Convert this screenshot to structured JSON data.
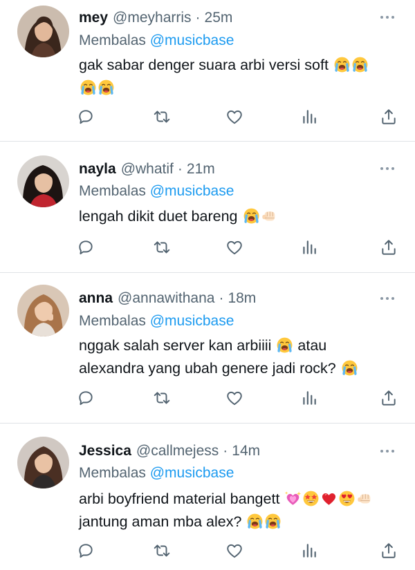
{
  "reply_prefix": "Membalas",
  "colors": {
    "link": "#1d9bf0",
    "secondary": "#536471",
    "text": "#0f1419"
  },
  "action_icons": [
    "reply-icon",
    "retweet-icon",
    "like-icon",
    "views-icon",
    "share-icon"
  ],
  "tweets": [
    {
      "name": "mey",
      "handle": "@meyharris",
      "dot": "·",
      "time": "25m",
      "reply_to": "@musicbase",
      "line1": "gak sabar denger suara arbi versi soft",
      "line2": "",
      "emojis": [
        "loudly-crying-face",
        "loudly-crying-face",
        "loudly-crying-face",
        "loudly-crying-face"
      ]
    },
    {
      "name": "nayla",
      "handle": "@whatif",
      "dot": "·",
      "time": "21m",
      "reply_to": "@musicbase",
      "line1": "lengah dikit duet bareng",
      "line2": "",
      "emojis": [
        "loudly-crying-face",
        "oncoming-fist"
      ]
    },
    {
      "name": "anna",
      "handle": "@annawithana",
      "dot": "·",
      "time": "18m",
      "reply_to": "@musicbase",
      "line1": "nggak salah server kan arbiiii",
      "line1_after": "atau",
      "line2": "alexandra yang ubah genere jadi rock?",
      "emojis": [
        "loudly-crying-face",
        "loudly-crying-face"
      ]
    },
    {
      "name": "Jessica",
      "handle": "@callmejess",
      "dot": "·",
      "time": "14m",
      "reply_to": "@musicbase",
      "line1": "arbi boyfriend material bangett",
      "line2": "jantung aman mba alex?",
      "emojis": [
        "sparkling-heart",
        "star-struck",
        "red-heart",
        "smiling-face-with-heart-eyes",
        "oncoming-fist",
        "loudly-crying-face",
        "loudly-crying-face"
      ]
    }
  ]
}
